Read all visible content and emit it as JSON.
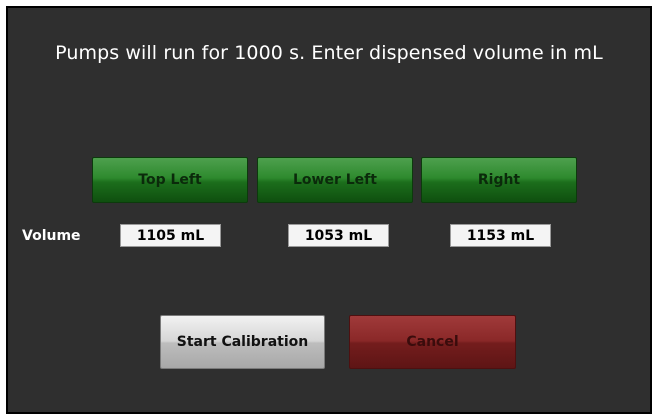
{
  "dialog": {
    "title": "Pumps will run for 1000 s. Enter dispensed volume in mL"
  },
  "pumps": [
    {
      "label": "Top Left",
      "volume": "1105 mL"
    },
    {
      "label": "Lower Left",
      "volume": "1053 mL"
    },
    {
      "label": "Right",
      "volume": "1153 mL"
    }
  ],
  "volume_label": "Volume",
  "actions": {
    "start_label": "Start Calibration",
    "cancel_label": "Cancel"
  },
  "colors": {
    "background": "#2f2f2f",
    "pump_button": "#2e8a2e",
    "start_button": "#d6d6d6",
    "cancel_button": "#8a2828"
  }
}
